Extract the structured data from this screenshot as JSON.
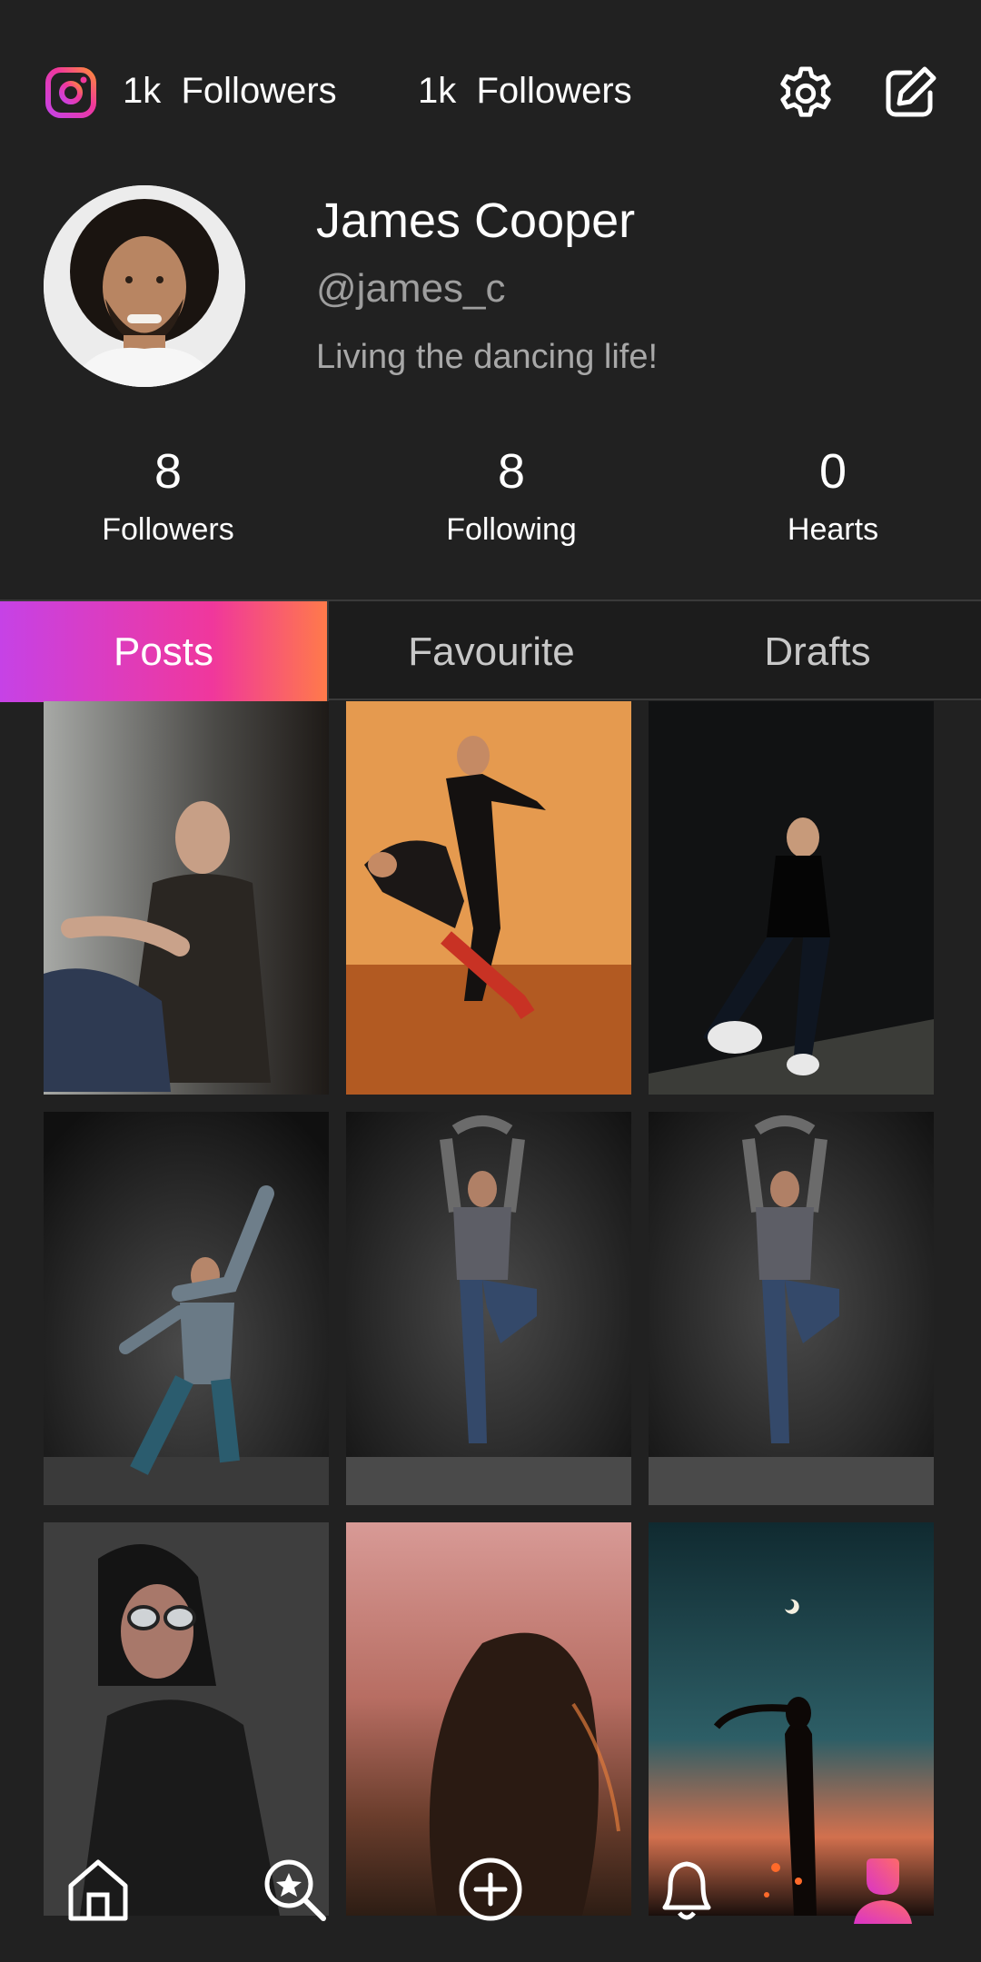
{
  "header": {
    "instagram_icon": "instagram-icon",
    "chip1_count": "1k",
    "chip1_label": "Followers",
    "chip2_count": "1k",
    "chip2_label": "Followers",
    "settings_icon": "gear-icon",
    "edit_icon": "edit-square-icon"
  },
  "profile": {
    "name": "James Cooper",
    "handle": "@james_c",
    "bio": "Living the dancing life!"
  },
  "stats": [
    {
      "value": "8",
      "label": "Followers"
    },
    {
      "value": "8",
      "label": "Following"
    },
    {
      "value": "0",
      "label": "Hearts"
    }
  ],
  "tabs": [
    {
      "label": "Posts",
      "active": true
    },
    {
      "label": "Favourite",
      "active": false
    },
    {
      "label": "Drafts",
      "active": false
    }
  ],
  "posts": [
    {
      "subject": "man-sitting-against-wall"
    },
    {
      "subject": "couple-ballroom-dancing"
    },
    {
      "subject": "man-dancing-dark-room"
    },
    {
      "subject": "dancer-arm-raised"
    },
    {
      "subject": "dancer-on-one-leg"
    },
    {
      "subject": "dancer-on-one-leg"
    },
    {
      "subject": "woman-sunglasses-portrait"
    },
    {
      "subject": "woman-hair-sunset"
    },
    {
      "subject": "silhouette-night-sky"
    }
  ],
  "bottom_nav": [
    {
      "icon": "home-icon"
    },
    {
      "icon": "search-star-icon"
    },
    {
      "icon": "add-circle-icon"
    },
    {
      "icon": "bell-icon"
    },
    {
      "icon": "profile-icon",
      "active": true
    }
  ],
  "colors": {
    "background": "#212121",
    "accent_start": "#c642e6",
    "accent_mid": "#f0379c",
    "accent_end": "#ff7a4a",
    "muted_text": "#9e9e9e"
  }
}
